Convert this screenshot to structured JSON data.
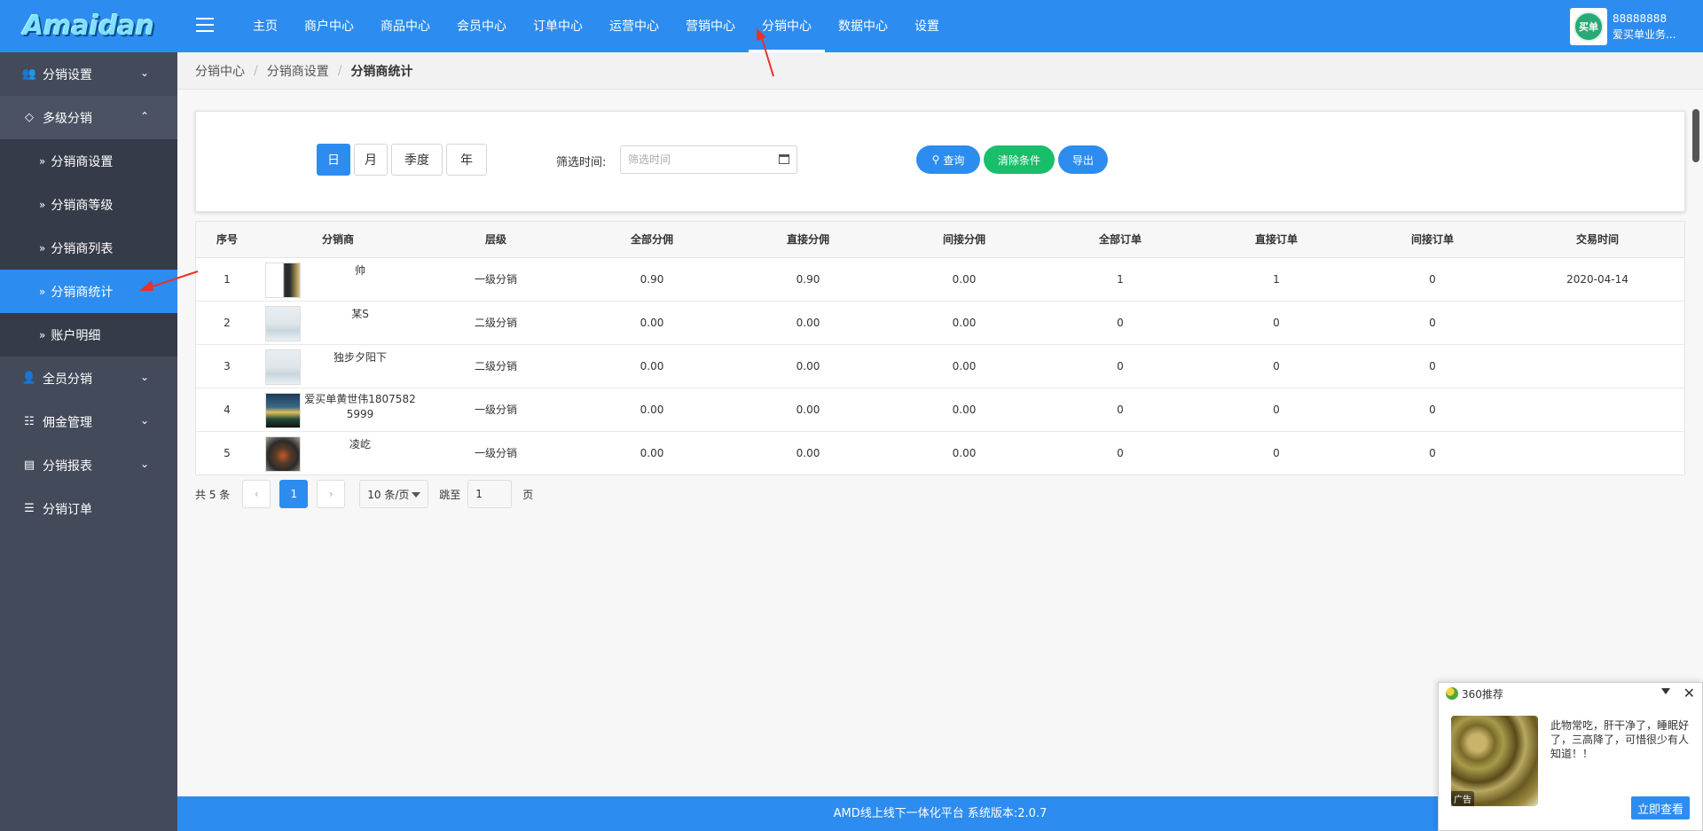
{
  "brand": {
    "logo": "Amaidan"
  },
  "topnav": {
    "items": [
      "主页",
      "商户中心",
      "商品中心",
      "会员中心",
      "订单中心",
      "运营中心",
      "营销中心",
      "分销中心",
      "数据中心",
      "设置"
    ],
    "active_index": 7
  },
  "user": {
    "id": "88888888",
    "name": "爱买单业务...",
    "avatar_text": "买单"
  },
  "sidebar": {
    "groups": [
      {
        "label": "分销设置",
        "icon": "users-icon"
      },
      {
        "label": "多级分销",
        "icon": "diamond-icon",
        "children": [
          "分销商设置",
          "分销商等级",
          "分销商列表",
          "分销商统计",
          "账户明细"
        ],
        "active_child": 3
      },
      {
        "label": "全员分销",
        "icon": "user-icon"
      },
      {
        "label": "佣金管理",
        "icon": "database-icon"
      },
      {
        "label": "分销报表",
        "icon": "report-icon"
      },
      {
        "label": "分销订单",
        "icon": "list-icon"
      }
    ]
  },
  "breadcrumb": [
    "分销中心",
    "分销商设置",
    "分销商统计"
  ],
  "filter": {
    "period_tabs": [
      "日",
      "月",
      "季度",
      "年"
    ],
    "active_period": 0,
    "time_label": "筛选时间:",
    "time_placeholder": "筛选时间",
    "query_label": "查询",
    "clear_label": "清除条件",
    "export_label": "导出"
  },
  "table": {
    "headers": [
      "序号",
      "分销商",
      "层级",
      "全部分佣",
      "直接分佣",
      "间接分佣",
      "全部订单",
      "直接订单",
      "间接订单",
      "交易时间"
    ],
    "rows": [
      [
        "1",
        "帅",
        "一级分销",
        "0.90",
        "0.90",
        "0.00",
        "1",
        "1",
        "0",
        "2020-04-14"
      ],
      [
        "2",
        "某S",
        "二级分销",
        "0.00",
        "0.00",
        "0.00",
        "0",
        "0",
        "0",
        ""
      ],
      [
        "3",
        "独步夕阳下",
        "二级分销",
        "0.00",
        "0.00",
        "0.00",
        "0",
        "0",
        "0",
        ""
      ],
      [
        "4",
        "爱买单黄世伟18075825999",
        "一级分销",
        "0.00",
        "0.00",
        "0.00",
        "0",
        "0",
        "0",
        ""
      ],
      [
        "5",
        "凌屹",
        "一级分销",
        "0.00",
        "0.00",
        "0.00",
        "0",
        "0",
        "0",
        ""
      ]
    ]
  },
  "pager": {
    "total": "共 5 条",
    "prev": "‹",
    "page": "1",
    "next": "›",
    "size": "10 条/页",
    "jump_label": "跳至",
    "jump_value": "1",
    "page_suffix": "页"
  },
  "footer": {
    "text": "AMD线上线下一体化平台 系统版本:2.0.7"
  },
  "popup": {
    "title": "360推荐",
    "image_tag": "广告",
    "text": "此物常吃，肝干净了，睡眠好了，三高降了，可惜很少有人知道！！",
    "button": "立即查看"
  },
  "colors": {
    "primary": "#2d8cf0",
    "success": "#19be6b",
    "sidebar": "#434a5a",
    "annotation": "#e8322a"
  }
}
